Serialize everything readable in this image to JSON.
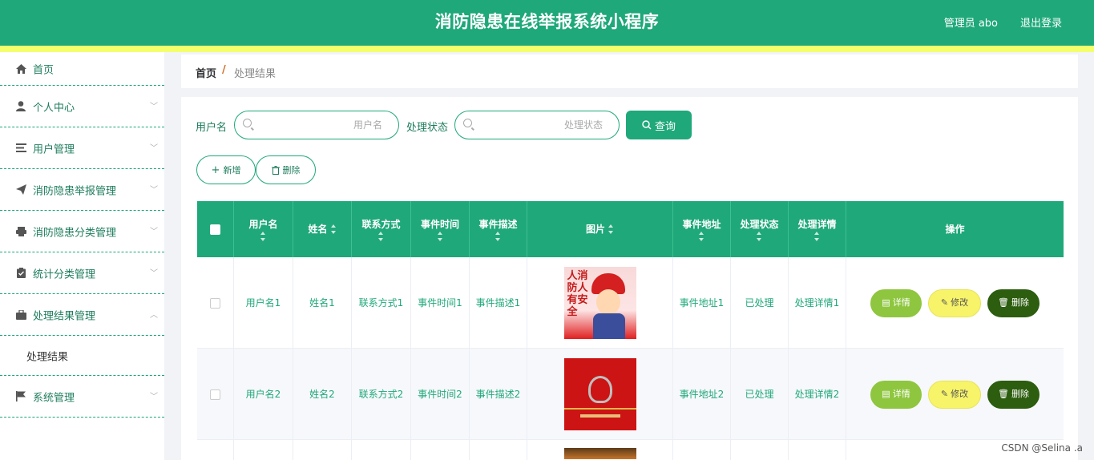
{
  "header": {
    "title": "消防隐患在线举报系统小程序",
    "user": "管理员 abo",
    "logout": "退出登录"
  },
  "sidebar": {
    "items": [
      {
        "label": "首页",
        "icon": "home-icon",
        "expandable": false
      },
      {
        "label": "个人中心",
        "icon": "user-icon",
        "expandable": true
      },
      {
        "label": "用户管理",
        "icon": "list-icon",
        "expandable": true
      },
      {
        "label": "消防隐患举报管理",
        "icon": "send-icon",
        "expandable": true
      },
      {
        "label": "消防隐患分类管理",
        "icon": "printer-icon",
        "expandable": true
      },
      {
        "label": "统计分类管理",
        "icon": "clipboard-icon",
        "expandable": true
      },
      {
        "label": "处理结果管理",
        "icon": "briefcase-icon",
        "expandable": true,
        "expanded": true
      },
      {
        "label": "系统管理",
        "icon": "flag-icon",
        "expandable": true
      }
    ],
    "sub_item": "处理结果"
  },
  "breadcrumb": {
    "home": "首页",
    "separator": "/",
    "current": "处理结果"
  },
  "search": {
    "username_label": "用户名",
    "username_placeholder": "用户名",
    "status_label": "处理状态",
    "status_placeholder": "处理状态",
    "query_button": "查询"
  },
  "toolbar": {
    "add": "新增",
    "delete": "删除"
  },
  "table": {
    "headers": [
      "用户名",
      "姓名",
      "联系方式",
      "事件时间",
      "事件描述",
      "图片",
      "事件地址",
      "处理状态",
      "处理详情",
      "操作"
    ],
    "rows": [
      {
        "username": "用户名1",
        "name": "姓名1",
        "contact": "联系方式1",
        "time": "事件时间1",
        "desc": "事件描述1",
        "address": "事件地址1",
        "status": "已处理",
        "detail": "处理详情1"
      },
      {
        "username": "用户名2",
        "name": "姓名2",
        "contact": "联系方式2",
        "time": "事件时间2",
        "desc": "事件描述2",
        "address": "事件地址2",
        "status": "已处理",
        "detail": "处理详情2"
      }
    ],
    "image1_text": "人消\n防人\n有安\n全",
    "actions": {
      "detail": "详情",
      "edit": "修改",
      "delete": "删除"
    }
  },
  "watermark": "CSDN @Selina .a",
  "colors": {
    "primary": "#1fa879",
    "stripe": "#f4ff6c",
    "detail_btn": "#8ec63f",
    "edit_btn": "#f7f46a",
    "delete_btn": "#2d5d0f"
  }
}
